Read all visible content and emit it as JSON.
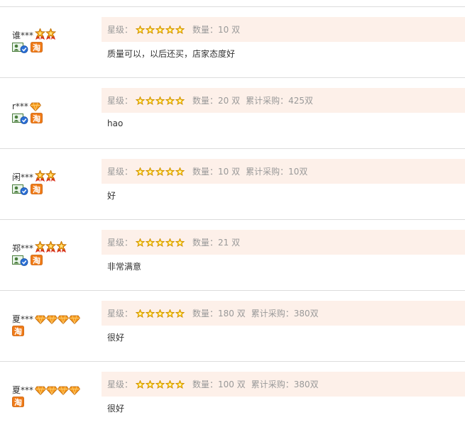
{
  "labels": {
    "rating": "星级：",
    "quantity_prefix": "数量：",
    "cumulative_prefix": "累计采购："
  },
  "colors": {
    "meta_background": "#fdf0e9",
    "divider": "#dcdcdc",
    "muted_text": "#999999",
    "star_fill": "#ffcc00",
    "crown_fill": "#f7a51a",
    "diamond_fill": "#f59a1d"
  },
  "reviews": [
    {
      "user": "谁***",
      "badge_icon": "crown-icon",
      "badge_count": 2,
      "verified_icon": true,
      "taobao_icon": true,
      "rating": 5,
      "quantity": "数量：10 双",
      "cumulative": "",
      "comment": "质量可以，以后还买，店家态度好"
    },
    {
      "user": "r***",
      "badge_icon": "diamond-icon",
      "badge_count": 1,
      "verified_icon": true,
      "taobao_icon": true,
      "rating": 5,
      "quantity": "数量：20 双",
      "cumulative": "累计采购：425双",
      "comment": "hao"
    },
    {
      "user": "闲***",
      "badge_icon": "crown-icon",
      "badge_count": 2,
      "verified_icon": true,
      "taobao_icon": true,
      "rating": 5,
      "quantity": "数量：10 双",
      "cumulative": "累计采购：10双",
      "comment": "好"
    },
    {
      "user": "郑***",
      "badge_icon": "crown-icon",
      "badge_count": 3,
      "verified_icon": true,
      "taobao_icon": true,
      "rating": 5,
      "quantity": "数量：21 双",
      "cumulative": "",
      "comment": "非常满意"
    },
    {
      "user": "夏***",
      "badge_icon": "diamond-icon",
      "badge_count": 4,
      "verified_icon": false,
      "taobao_icon": true,
      "rating": 5,
      "quantity": "数量：180 双",
      "cumulative": "累计采购：380双",
      "comment": "很好"
    },
    {
      "user": "夏***",
      "badge_icon": "diamond-icon",
      "badge_count": 4,
      "verified_icon": false,
      "taobao_icon": true,
      "rating": 5,
      "quantity": "数量：100 双",
      "cumulative": "累计采购：380双",
      "comment": "很好"
    }
  ]
}
